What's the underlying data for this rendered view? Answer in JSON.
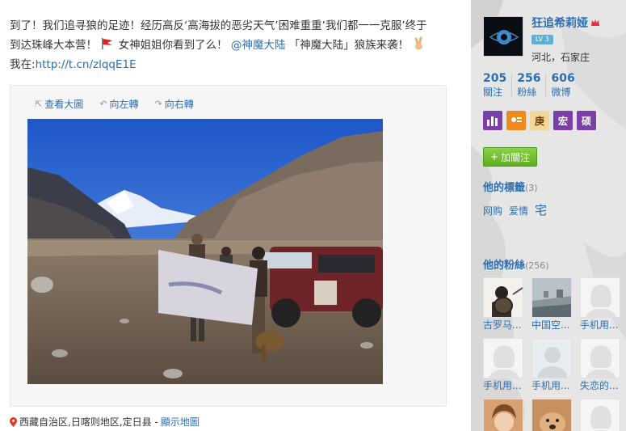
{
  "post": {
    "line1": "到了！我们追寻狼的足迹！经历高反‘高海拔的恶劣天气’困难重重’我们都一一克服’终于",
    "line2_a": "到达珠峰大本营！",
    "line2_b": "女神姐姐你看到了么！",
    "mention": "@神魔大陆",
    "line2_c": "「神魔大陆」狼族来袭！",
    "line3_a": "我在:",
    "link": "http://t.cn/zlqqE1E"
  },
  "media_tools": {
    "view_large": "查看大圖",
    "rotate_left": "向左轉",
    "rotate_right": "向右轉"
  },
  "location": {
    "text": "西藏自治区,日喀则地区,定日县 - ",
    "map_link": "顯示地圖"
  },
  "profile": {
    "nickname": "狂追希莉娅",
    "level": "LV 3",
    "location": "河北，石家庄",
    "stats": [
      {
        "num": "205",
        "label": "關注"
      },
      {
        "num": "256",
        "label": "粉絲"
      },
      {
        "num": "606",
        "label": "微博"
      }
    ],
    "medals": [
      "",
      "",
      "庚",
      "宏",
      "硕"
    ],
    "follow_label": "加關注"
  },
  "tags_section": {
    "title": "他的標籤",
    "count": "(3)",
    "tags": [
      "网购",
      "爱情",
      "宅"
    ]
  },
  "fans_section": {
    "title": "他的粉絲",
    "count": "(256)",
    "fans": [
      {
        "name": "古罗马..."
      },
      {
        "name": "中国空..."
      },
      {
        "name": "手机用..."
      },
      {
        "name": "手机用..."
      },
      {
        "name": "手机用..."
      },
      {
        "name": "失恋的..."
      },
      {
        "name": ""
      },
      {
        "name": ""
      },
      {
        "name": ""
      }
    ]
  },
  "colors": {
    "link": "#2b6fb0",
    "follow_green": "#6ab82c",
    "sidebar_bg": "#e9e9e9"
  }
}
